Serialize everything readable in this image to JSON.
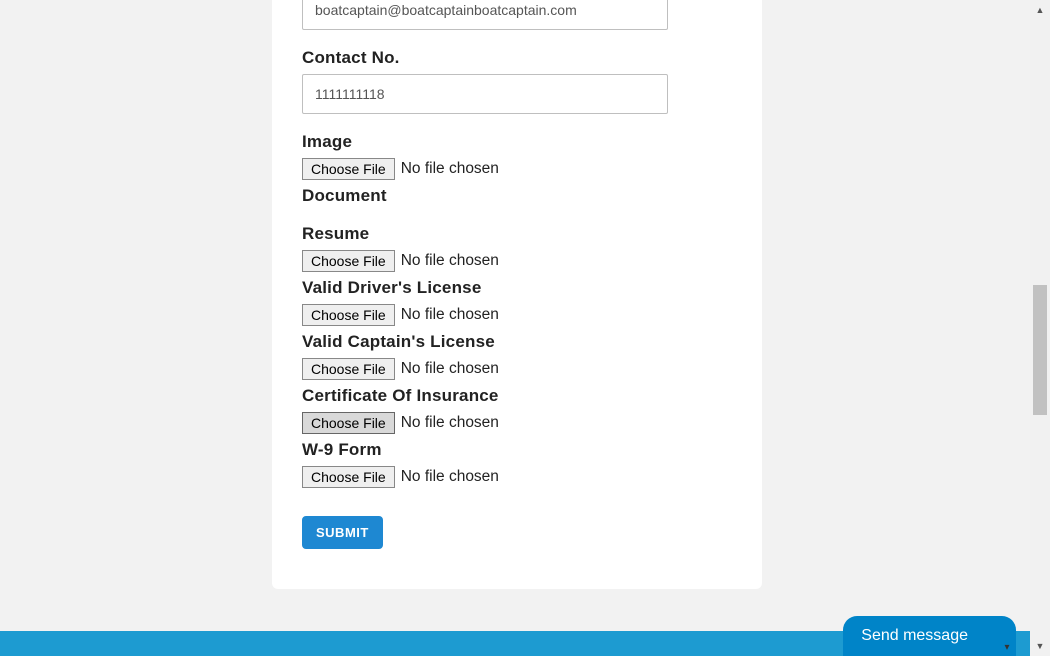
{
  "form": {
    "email": {
      "value": "boatcaptain@boatcaptainboatcaptain.com"
    },
    "contact_label": "Contact No.",
    "contact": {
      "value": "1111111118"
    },
    "image_label": "Image",
    "document_label": "Document",
    "resume_label": "Resume",
    "driver_license_label": "Valid Driver's License",
    "captain_license_label": "Valid Captain's License",
    "certificate_label": "Certificate Of Insurance",
    "w9_label": "W-9 Form",
    "choose_file": "Choose File",
    "no_file": "No file chosen",
    "submit_label": "SUBMIT"
  },
  "chat": {
    "label": "Send message"
  },
  "scroll": {
    "up": "▲",
    "down": "▼"
  }
}
